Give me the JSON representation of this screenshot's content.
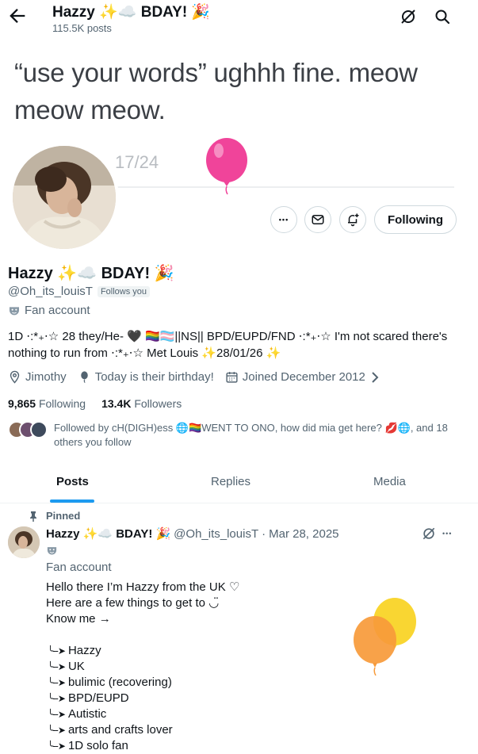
{
  "header": {
    "title": "Hazzy ✨☁️ BDAY! 🎉",
    "post_count": "115.5K posts"
  },
  "banner": {
    "text": "“use your words” ughhh fine. meow meow meow.",
    "date_fragment": "17/24"
  },
  "actions": {
    "more_label": "•••",
    "following_label": "Following"
  },
  "profile": {
    "name": "Hazzy ✨☁️ BDAY! 🎉",
    "handle": "@Oh_its_louisT",
    "follows_you": "Follows you",
    "category": "Fan account",
    "bio": "1D ⋅:*₊⋅☆ 28 they/He- 🖤 🏳️‍🌈🏳️‍⚧️||NS|| BPD/EUPD/FND ⋅:*₊⋅☆ I'm not scared there's nothing to run from ⋅:*₊⋅☆ Met Louis ✨28/01/26 ✨",
    "location": "Jimothy",
    "birthday": "Today is their birthday!",
    "joined": "Joined December 2012",
    "following_count": "9,865",
    "following_label": "Following",
    "followers_count": "13.4K",
    "followers_label": "Followers",
    "followed_by": "Followed by cH(DIGH)ess 🌐🏳️‍🌈WENT TO ONO, how did mia get here? 💋🌐, and 18 others you follow"
  },
  "tabs": [
    {
      "label": "Posts",
      "active": true
    },
    {
      "label": "Replies",
      "active": false
    },
    {
      "label": "Media",
      "active": false
    }
  ],
  "post": {
    "pinned_label": "Pinned",
    "author_name": "Hazzy ✨☁️ BDAY! 🎉",
    "author_handle": "@Oh_its_louisT",
    "separator": "·",
    "date": "Mar 28, 2025",
    "category": "Fan account",
    "more_label": "•••",
    "body": [
      "Hello there I’m Hazzy from the UK ♡",
      "Here are a few things to get to ◡̈",
      "Know me →"
    ],
    "arrow": "╰--➤",
    "list": [
      "Hazzy",
      "UK",
      "bulimic (recovering)",
      "BPD/EUPD",
      "Autistic",
      "arts and crafts lover",
      "1D solo fan"
    ]
  },
  "colors": {
    "accent": "#1d9bf0",
    "text": "#0f1419",
    "muted": "#536471",
    "border": "#cfd9de",
    "balloon_pink": "#f0449a",
    "balloon_yellow": "#f9d632",
    "balloon_orange": "#f79a3a"
  },
  "icons": [
    "back-arrow-icon",
    "grok-icon",
    "search-icon",
    "more-icon",
    "message-icon",
    "notification-bell-icon",
    "mask-icon",
    "location-icon",
    "balloon-icon",
    "calendar-icon",
    "chevron-right-icon",
    "pin-icon"
  ]
}
